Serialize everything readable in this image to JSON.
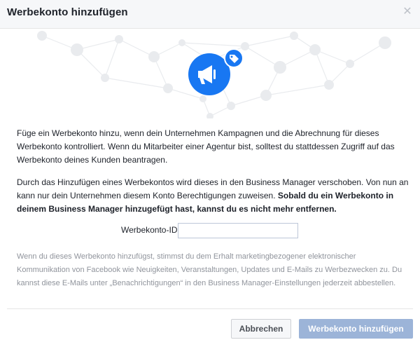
{
  "dialog": {
    "title": "Werbekonto hinzufügen",
    "close_icon": "close-icon"
  },
  "hero": {
    "icon": "megaphone-icon",
    "badge_icon": "tag-icon",
    "accent_color": "#1877f2"
  },
  "body": {
    "paragraph1": "Füge ein Werbekonto hinzu, wenn dein Unternehmen Kampagnen und die Abrechnung für dieses Werbekonto kontrolliert. Wenn du Mitarbeiter einer Agentur bist, solltest du stattdessen Zugriff auf das Werbekonto deines Kunden beantragen.",
    "paragraph2_regular": "Durch das Hinzufügen eines Werbekontos wird dieses in den Business Manager verschoben. Von nun an kann nur dein Unternehmen diesem Konto Berechtigungen zuweisen. ",
    "paragraph2_bold": "Sobald du ein Werbekonto in deinem Business Manager hinzugefügt hast, kannst du es nicht mehr entfernen."
  },
  "form": {
    "account_id_label": "Werbekonto-ID",
    "account_id_value": ""
  },
  "notice": "Wenn du dieses Werbekonto hinzufügst, stimmst du dem Erhalt marketingbezogener elektronischer Kommunikation von Facebook wie Neuigkeiten, Veranstaltungen, Updates und E-Mails zu Werbezwecken zu. Du kannst diese E-Mails unter „Benachrichtigungen“ in den Business Manager-Einstellungen jederzeit abbestellen.",
  "footer": {
    "cancel_label": "Abbrechen",
    "add_label": "Werbekonto hinzufügen",
    "add_button_color": "#9cb4d8"
  }
}
